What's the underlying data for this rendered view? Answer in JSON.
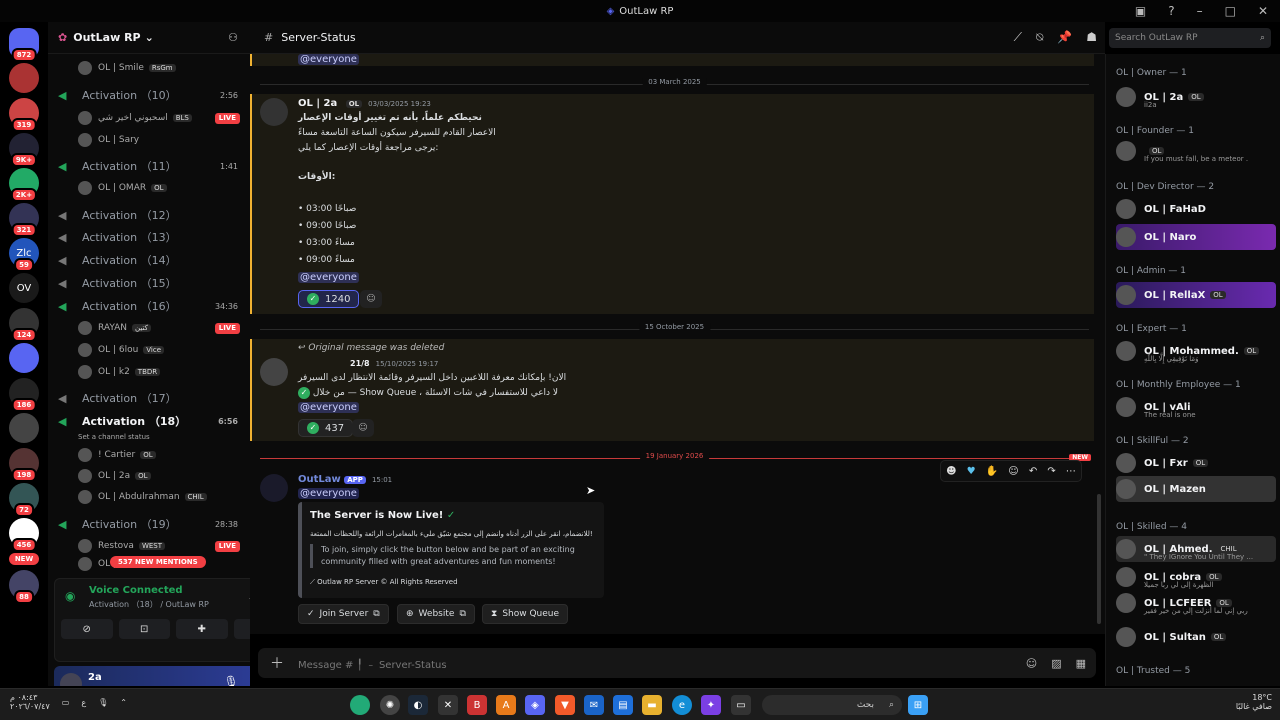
{
  "window": {
    "title": "OutLaw RP"
  },
  "servers": [
    {
      "label": "",
      "badge": "872",
      "color": "#5865f2"
    },
    {
      "label": "",
      "badge": "",
      "color": "#a33"
    },
    {
      "label": "",
      "badge": "319",
      "color": "#c44"
    },
    {
      "label": "",
      "badge": "9K+",
      "color": "#223"
    },
    {
      "label": "",
      "badge": "2K+",
      "color": "#2a6"
    },
    {
      "label": "",
      "badge": "321",
      "color": "#335"
    },
    {
      "label": "Zlc",
      "badge": "59",
      "color": "#2255bb"
    },
    {
      "label": "OV",
      "badge": "",
      "color": "#1a1a1a"
    },
    {
      "label": "",
      "badge": "124",
      "color": "#333"
    },
    {
      "label": "",
      "badge": "",
      "color": "#5865f2"
    },
    {
      "label": "",
      "badge": "186",
      "color": "#222"
    },
    {
      "label": "",
      "badge": "",
      "color": "#444"
    },
    {
      "label": "",
      "badge": "198",
      "color": "#533"
    },
    {
      "label": "",
      "badge": "72",
      "color": "#355"
    },
    {
      "label": "",
      "badge": "456",
      "color": "#fff"
    },
    {
      "label": "",
      "badge": "88",
      "color": "#446"
    }
  ],
  "servers_new": "NEW",
  "channels": {
    "server_name": "OutLaw RP",
    "items": [
      {
        "kind": "user",
        "name": "OL | Smile",
        "tag": "RsGm"
      },
      {
        "kind": "voice",
        "name": "Activation （10）",
        "time": "2:56"
      },
      {
        "kind": "user",
        "name": "اسحبوني اخير شي",
        "tag": "BLS",
        "live": "LIVE"
      },
      {
        "kind": "user",
        "name": "OL | Sary"
      },
      {
        "kind": "voice",
        "name": "Activation （11）",
        "time": "1:41"
      },
      {
        "kind": "user",
        "name": "OL | OMAR",
        "tag": "OL"
      },
      {
        "kind": "voice",
        "name": "Activation （12）"
      },
      {
        "kind": "voice",
        "name": "Activation （13）"
      },
      {
        "kind": "voice",
        "name": "Activation （14）"
      },
      {
        "kind": "voice",
        "name": "Activation （15）"
      },
      {
        "kind": "voice",
        "name": "Activation （16）",
        "time": "34:36"
      },
      {
        "kind": "user",
        "name": "RAYAN",
        "tag": "كتين",
        "live": "LIVE"
      },
      {
        "kind": "user",
        "name": "OL | 6lou",
        "tag": "Vice"
      },
      {
        "kind": "user",
        "name": "OL | k2",
        "tag": "TBDR"
      },
      {
        "kind": "voice",
        "name": "Activation （17）"
      },
      {
        "kind": "voice",
        "name": "Activation （18）",
        "time": "6:56",
        "active": true
      },
      {
        "kind": "status",
        "name": "Set a channel status"
      },
      {
        "kind": "user",
        "name": "! Cartier",
        "tag": "OL"
      },
      {
        "kind": "user",
        "name": "OL | 2a",
        "tag": "OL"
      },
      {
        "kind": "user",
        "name": "OL | Abdulrahman",
        "tag": "CHIL"
      },
      {
        "kind": "voice",
        "name": "Activation （19）",
        "time": "28:38"
      },
      {
        "kind": "user",
        "name": "Restova",
        "tag": "WEST",
        "live": "LIVE"
      },
      {
        "kind": "user",
        "name": "OL | ...",
        "tag": "CHIL"
      }
    ],
    "mentions_pill": "537 NEW MENTIONS"
  },
  "voice": {
    "title": "Voice Connected",
    "sub": "Activation （18） / OutLaw RP"
  },
  "user": {
    "name": "2a",
    "status": "ii2a"
  },
  "chat": {
    "channel": "Server-Status",
    "search_placeholder": "Search OutLaw RP",
    "top_mention": "@everyone",
    "sep1": "03 March 2025",
    "msg1": {
      "author": "OL | 2a",
      "badge": "OL",
      "time": "03/03/2025 19:23",
      "lines": [
        "نحيطكم علماً، بأنه تم تغيير أوقات الإعصار",
        "الاعصار القادم للسيرفر سيكون الساعة التاسعة مساءً",
        "يرجى مراجعة أوقات الإعصار كما يلي:",
        "الأوقات:"
      ],
      "times": [
        "03:00 صباحًا",
        "09:00 صباحًا",
        "03:00 مساءً",
        "09:00 مساءً"
      ],
      "mention": "@everyone",
      "reaction_count": "1240"
    },
    "sep2": "15 October 2025",
    "msg2": {
      "deleted": "Original message was deleted",
      "badge": "21/8",
      "time": "15/10/2025 19:17",
      "line1": "الان! بإمكانك معرفة اللاعبين داخل السيرفر وقائمة الانتظار لدى السيرفر",
      "line2": "من خلال — Show Queue ، لا داعي للاستفسار في شات الاسئلة",
      "mention": "@everyone",
      "reaction_count": "437"
    },
    "sep3": "19 January 2026",
    "sep3_new": "NEW",
    "msg3": {
      "author": "OutLaw",
      "app": "APP",
      "time": "15:01",
      "mention": "@everyone",
      "embed_title": "The Server is Now Live!",
      "embed_ar": "للانضمام، انقر على الزر أدناه وانضم إلى مجتمع شيّق مليء بالمغامرات الرائعة واللحظات الممتعة!",
      "embed_en": "To join, simply click the button below and be part of an exciting community filled with great adventures and fun moments!",
      "embed_footer": "Outlaw RP Server © All Rights Reserved",
      "buttons": [
        "Join Server",
        "Website",
        "Show Queue"
      ]
    },
    "composer_placeholder": "Message # ╿ ﹣ Server-Status"
  },
  "members": [
    {
      "header": "OL | Owner — 1"
    },
    {
      "name": "OL | 2a",
      "tag": "OL",
      "status": "ii2a"
    },
    {
      "header": "OL | Founder — 1"
    },
    {
      "name": "",
      "tag": "OL",
      "status": "If you must fall, be a meteor ."
    },
    {
      "header": "OL | Dev Director — 2"
    },
    {
      "name": "OL | FaHaD"
    },
    {
      "name": "OL | Naro"
    },
    {
      "header": "OL | Admin — 1"
    },
    {
      "name": "OL | RellaX",
      "tag": "OL"
    },
    {
      "header": "OL | Expert — 1"
    },
    {
      "name": "OL | Mohammed.",
      "tag": "OL",
      "status": "وَمَا تَوْفِيقِي إِلَّا بِاللَّهِ"
    },
    {
      "header": "OL | Monthly Employee — 1"
    },
    {
      "name": "OL | vAli",
      "status": "The real is one"
    },
    {
      "header": "OL | SkillFul — 2"
    },
    {
      "name": "OL | Fxr",
      "tag": "OL"
    },
    {
      "name": "OL | Mazen"
    },
    {
      "header": "OL | Skilled — 4"
    },
    {
      "name": "OL | Ahmed.",
      "tag": "CHIL",
      "status": "\" They IGnore You Until They ..."
    },
    {
      "name": "OL | cobra",
      "tag": "OL",
      "status": "الظهرة إلى لي ربا جميلا"
    },
    {
      "name": "OL | LCFEER",
      "tag": "OL",
      "status": "ربي إني لما أنزلت إلي من خير فقير"
    },
    {
      "name": "OL | Sultan",
      "tag": "OL"
    },
    {
      "header": "OL | Trusted — 5"
    }
  ],
  "taskbar": {
    "search": "بحث",
    "time": "٠٨:٤٣ م",
    "date": "٢٠٢٦/٠٧/٤٧",
    "weather": "18°C",
    "weather_sub": "صافي غالبًا",
    "lang": "ع"
  }
}
